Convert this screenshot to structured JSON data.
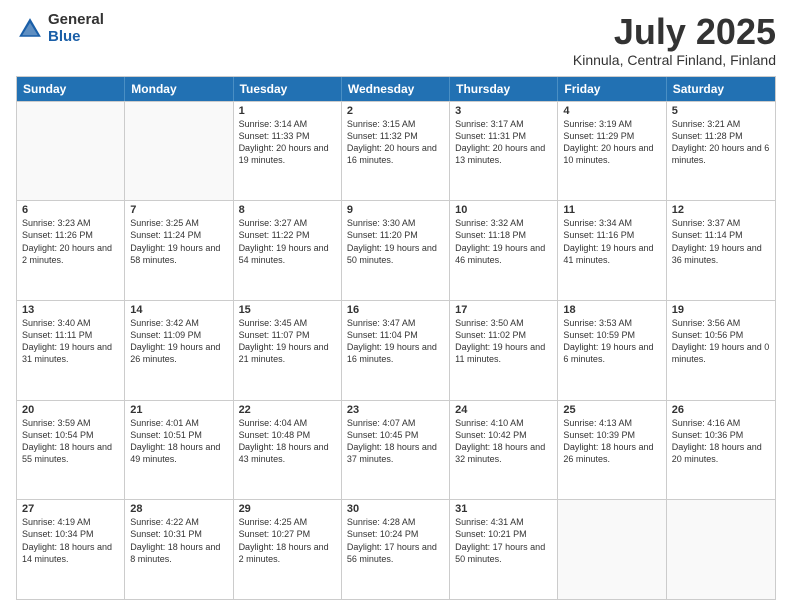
{
  "logo": {
    "general": "General",
    "blue": "Blue"
  },
  "title": "July 2025",
  "subtitle": "Kinnula, Central Finland, Finland",
  "headers": [
    "Sunday",
    "Monday",
    "Tuesday",
    "Wednesday",
    "Thursday",
    "Friday",
    "Saturday"
  ],
  "rows": [
    [
      {
        "day": "",
        "text": "",
        "empty": true
      },
      {
        "day": "",
        "text": "",
        "empty": true
      },
      {
        "day": "1",
        "text": "Sunrise: 3:14 AM\nSunset: 11:33 PM\nDaylight: 20 hours\nand 19 minutes."
      },
      {
        "day": "2",
        "text": "Sunrise: 3:15 AM\nSunset: 11:32 PM\nDaylight: 20 hours\nand 16 minutes."
      },
      {
        "day": "3",
        "text": "Sunrise: 3:17 AM\nSunset: 11:31 PM\nDaylight: 20 hours\nand 13 minutes."
      },
      {
        "day": "4",
        "text": "Sunrise: 3:19 AM\nSunset: 11:29 PM\nDaylight: 20 hours\nand 10 minutes."
      },
      {
        "day": "5",
        "text": "Sunrise: 3:21 AM\nSunset: 11:28 PM\nDaylight: 20 hours\nand 6 minutes."
      }
    ],
    [
      {
        "day": "6",
        "text": "Sunrise: 3:23 AM\nSunset: 11:26 PM\nDaylight: 20 hours\nand 2 minutes."
      },
      {
        "day": "7",
        "text": "Sunrise: 3:25 AM\nSunset: 11:24 PM\nDaylight: 19 hours\nand 58 minutes."
      },
      {
        "day": "8",
        "text": "Sunrise: 3:27 AM\nSunset: 11:22 PM\nDaylight: 19 hours\nand 54 minutes."
      },
      {
        "day": "9",
        "text": "Sunrise: 3:30 AM\nSunset: 11:20 PM\nDaylight: 19 hours\nand 50 minutes."
      },
      {
        "day": "10",
        "text": "Sunrise: 3:32 AM\nSunset: 11:18 PM\nDaylight: 19 hours\nand 46 minutes."
      },
      {
        "day": "11",
        "text": "Sunrise: 3:34 AM\nSunset: 11:16 PM\nDaylight: 19 hours\nand 41 minutes."
      },
      {
        "day": "12",
        "text": "Sunrise: 3:37 AM\nSunset: 11:14 PM\nDaylight: 19 hours\nand 36 minutes."
      }
    ],
    [
      {
        "day": "13",
        "text": "Sunrise: 3:40 AM\nSunset: 11:11 PM\nDaylight: 19 hours\nand 31 minutes."
      },
      {
        "day": "14",
        "text": "Sunrise: 3:42 AM\nSunset: 11:09 PM\nDaylight: 19 hours\nand 26 minutes."
      },
      {
        "day": "15",
        "text": "Sunrise: 3:45 AM\nSunset: 11:07 PM\nDaylight: 19 hours\nand 21 minutes."
      },
      {
        "day": "16",
        "text": "Sunrise: 3:47 AM\nSunset: 11:04 PM\nDaylight: 19 hours\nand 16 minutes."
      },
      {
        "day": "17",
        "text": "Sunrise: 3:50 AM\nSunset: 11:02 PM\nDaylight: 19 hours\nand 11 minutes."
      },
      {
        "day": "18",
        "text": "Sunrise: 3:53 AM\nSunset: 10:59 PM\nDaylight: 19 hours\nand 6 minutes."
      },
      {
        "day": "19",
        "text": "Sunrise: 3:56 AM\nSunset: 10:56 PM\nDaylight: 19 hours\nand 0 minutes."
      }
    ],
    [
      {
        "day": "20",
        "text": "Sunrise: 3:59 AM\nSunset: 10:54 PM\nDaylight: 18 hours\nand 55 minutes."
      },
      {
        "day": "21",
        "text": "Sunrise: 4:01 AM\nSunset: 10:51 PM\nDaylight: 18 hours\nand 49 minutes."
      },
      {
        "day": "22",
        "text": "Sunrise: 4:04 AM\nSunset: 10:48 PM\nDaylight: 18 hours\nand 43 minutes."
      },
      {
        "day": "23",
        "text": "Sunrise: 4:07 AM\nSunset: 10:45 PM\nDaylight: 18 hours\nand 37 minutes."
      },
      {
        "day": "24",
        "text": "Sunrise: 4:10 AM\nSunset: 10:42 PM\nDaylight: 18 hours\nand 32 minutes."
      },
      {
        "day": "25",
        "text": "Sunrise: 4:13 AM\nSunset: 10:39 PM\nDaylight: 18 hours\nand 26 minutes."
      },
      {
        "day": "26",
        "text": "Sunrise: 4:16 AM\nSunset: 10:36 PM\nDaylight: 18 hours\nand 20 minutes."
      }
    ],
    [
      {
        "day": "27",
        "text": "Sunrise: 4:19 AM\nSunset: 10:34 PM\nDaylight: 18 hours\nand 14 minutes."
      },
      {
        "day": "28",
        "text": "Sunrise: 4:22 AM\nSunset: 10:31 PM\nDaylight: 18 hours\nand 8 minutes."
      },
      {
        "day": "29",
        "text": "Sunrise: 4:25 AM\nSunset: 10:27 PM\nDaylight: 18 hours\nand 2 minutes."
      },
      {
        "day": "30",
        "text": "Sunrise: 4:28 AM\nSunset: 10:24 PM\nDaylight: 17 hours\nand 56 minutes."
      },
      {
        "day": "31",
        "text": "Sunrise: 4:31 AM\nSunset: 10:21 PM\nDaylight: 17 hours\nand 50 minutes."
      },
      {
        "day": "",
        "text": "",
        "empty": true
      },
      {
        "day": "",
        "text": "",
        "empty": true
      }
    ]
  ]
}
